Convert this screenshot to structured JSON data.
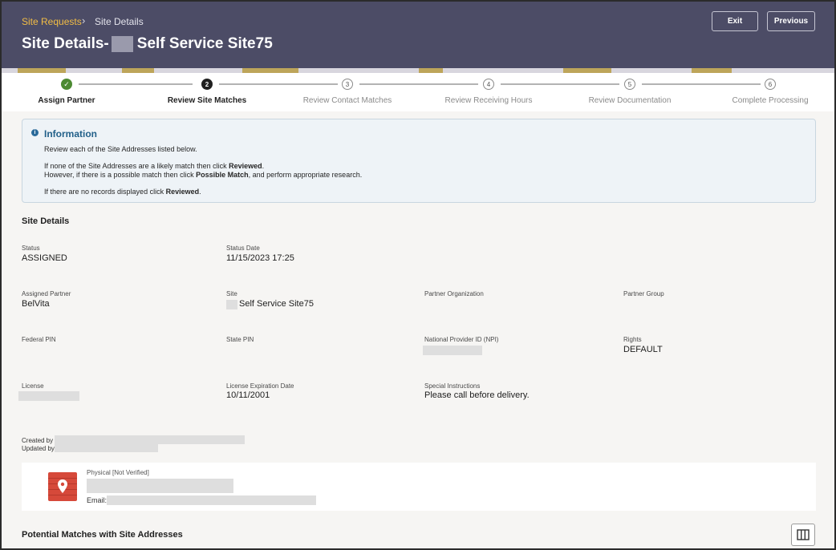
{
  "breadcrumb": {
    "parent": "Site Requests",
    "separator": "›",
    "current": "Site Details"
  },
  "page_title": {
    "prefix": "Site Details-",
    "suffix": "Self Service Site75"
  },
  "header_buttons": {
    "exit": "Exit",
    "previous": "Previous"
  },
  "stepper": {
    "steps": [
      {
        "marker": "✓",
        "label": "Assign Partner",
        "state": "done"
      },
      {
        "marker": "2",
        "label": "Review Site Matches",
        "state": "active"
      },
      {
        "marker": "3",
        "label": "Review Contact Matches",
        "state": "todo"
      },
      {
        "marker": "4",
        "label": "Review Receiving Hours",
        "state": "todo"
      },
      {
        "marker": "5",
        "label": "Review Documentation",
        "state": "todo"
      },
      {
        "marker": "6",
        "label": "Complete Processing",
        "state": "todo"
      }
    ]
  },
  "information": {
    "icon": "info-icon",
    "title": "Information",
    "line1": "Review each of the Site Addresses listed below.",
    "line2_pre": "If none of the Site Addresses are a likely match then click ",
    "line2_bold": "Reviewed",
    "line2_post": ".",
    "line3_pre": "However, if there is a possible match then click ",
    "line3_bold": "Possible Match",
    "line3_post": ", and perform appropriate research.",
    "line4_pre": "If there are no records displayed click ",
    "line4_bold": "Reviewed",
    "line4_post": "."
  },
  "site_details": {
    "title": "Site Details",
    "status_label": "Status",
    "status_value": "ASSIGNED",
    "status_date_label": "Status Date",
    "status_date_value": "11/15/2023 17:25",
    "assigned_partner_label": "Assigned Partner",
    "assigned_partner_value": "BelVita",
    "site_label": "Site",
    "site_value": "Self Service Site75",
    "partner_org_label": "Partner Organization",
    "partner_group_label": "Partner Group",
    "federal_pin_label": "Federal PIN",
    "state_pin_label": "State PIN",
    "npi_label": "National Provider ID (NPI)",
    "rights_label": "Rights",
    "rights_value": "DEFAULT",
    "license_label": "License",
    "license_exp_label": "License Expiration Date",
    "license_exp_value": "10/11/2001",
    "special_label": "Special Instructions",
    "special_value": "Please call before delivery.",
    "created_by_label": "Created by",
    "updated_by_label": "Updated by"
  },
  "address": {
    "icon": "map-pin-icon",
    "type_label": "Physical [Not Verified]",
    "email_label": "Email:"
  },
  "potential_matches": {
    "title": "Potential Matches with Site Addresses",
    "columns_icon": "columns-icon"
  },
  "colors": {
    "header_bg": "#4c4c66",
    "breadcrumb_link": "#f2bd45",
    "info_title": "#226089",
    "step_done": "#4c8a32",
    "address_icon_bg": "#d6493a"
  }
}
